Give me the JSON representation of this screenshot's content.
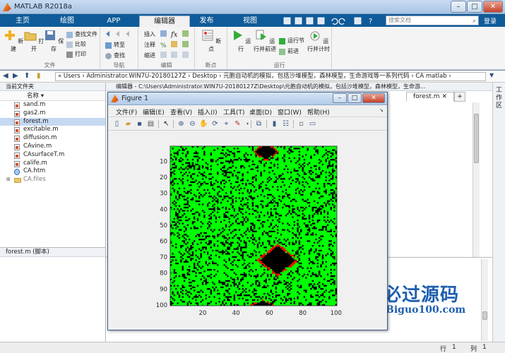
{
  "app": {
    "title": "MATLAB R2018a",
    "window_controls": {
      "minimize": "–",
      "maximize": "□",
      "close": "✕"
    }
  },
  "tabs": [
    {
      "label": "主页",
      "active": false
    },
    {
      "label": "绘图",
      "active": false
    },
    {
      "label": "APP",
      "active": false
    },
    {
      "label": "编辑器",
      "active": true
    },
    {
      "label": "发布",
      "active": false
    },
    {
      "label": "视图",
      "active": false
    }
  ],
  "search": {
    "placeholder": "搜索文档",
    "login_label": "登录"
  },
  "ribbon": {
    "groups": [
      {
        "label": "文件"
      },
      {
        "label": "导航"
      },
      {
        "label": "编辑"
      },
      {
        "label": "断点"
      },
      {
        "label": "运行"
      }
    ],
    "file": {
      "new": "新建",
      "open": "打开",
      "save": "保存",
      "find_files": "查找文件",
      "compare": "比较",
      "print": "打印"
    },
    "navigate": {
      "goto": "转至",
      "find": "查找"
    },
    "edit": {
      "insert": "插入",
      "comment": "注释",
      "indent": "缩进"
    },
    "breakpoints": {
      "label": "断点"
    },
    "run": {
      "run": "运行",
      "run_advance": "运行并前进",
      "run_section": "运行节",
      "advance": "前进",
      "run_time": "运行并计时"
    }
  },
  "address": {
    "path": "«  Users  ›  Administrator.WIN7U-20180127Z  ›  Desktop  ›  元胞自动机的模拟，包括沙堆模型，森林模型，生命游戏等一系列代码  ›  CA matlab  ›"
  },
  "file_browser": {
    "header": "当前文件夹",
    "name_column": "名称",
    "files": [
      {
        "name": "sand.m",
        "type": "m",
        "selected": false
      },
      {
        "name": "gas2.m",
        "type": "m",
        "selected": false
      },
      {
        "name": "forest.m",
        "type": "m",
        "selected": true
      },
      {
        "name": "excitable.m",
        "type": "m",
        "selected": false
      },
      {
        "name": "diffusion.m",
        "type": "m",
        "selected": false
      },
      {
        "name": "CAvine.m",
        "type": "m",
        "selected": false
      },
      {
        "name": "CAsurfaceT.m",
        "type": "m",
        "selected": false
      },
      {
        "name": "calife.m",
        "type": "m",
        "selected": false
      },
      {
        "name": "CA.htm",
        "type": "htm",
        "selected": false
      },
      {
        "name": "CA.files",
        "type": "folder",
        "selected": false
      }
    ],
    "details": "forest.m  (脚本)"
  },
  "editor": {
    "header": "编辑器 - C:\\Users\\Administrator.WIN7U-20180127Z\\Desktop\\元胞自动机的模拟，包括沙堆模型，森林模型，生命游...",
    "tab": "forest.m",
    "add_tab": "+",
    "side_label": "工作区"
  },
  "status": {
    "row_label": "行",
    "row_value": "1",
    "col_label": "列",
    "col_value": "1"
  },
  "figure": {
    "title": "Figure 1",
    "menu": [
      "文件(F)",
      "编辑(E)",
      "查看(V)",
      "插入(I)",
      "工具(T)",
      "桌面(D)",
      "窗口(W)",
      "帮助(H)"
    ],
    "toolbar_icons": [
      "new-figure-icon",
      "open-icon",
      "save-icon",
      "print-icon",
      "pointer-icon",
      "zoom-in-icon",
      "zoom-out-icon",
      "pan-icon",
      "rotate-icon",
      "data-cursor-icon",
      "brush-icon",
      "link-icon",
      "colorbar-icon",
      "legend-icon",
      "hide-tools-icon",
      "dock-icon"
    ]
  },
  "chart_data": {
    "type": "heatmap",
    "grid_size": [
      100,
      100
    ],
    "xlim": [
      0.5,
      100.5
    ],
    "ylim": [
      0.5,
      100.5
    ],
    "y_direction": "reverse",
    "xticks": [
      20,
      40,
      60,
      80,
      100
    ],
    "yticks": [
      10,
      20,
      30,
      40,
      50,
      60,
      70,
      80,
      90,
      100
    ],
    "colors": {
      "tree": "#00ff00",
      "empty": "#000000",
      "fire": "#ff0000"
    },
    "empty_density": 0.22,
    "burned_regions": [
      {
        "center": [
          58,
          4
        ],
        "rx": 7,
        "ry": 5
      },
      {
        "center": [
          65,
          72
        ],
        "rx": 11,
        "ry": 9
      },
      {
        "center": [
          56,
          100
        ],
        "rx": 6,
        "ry": 3
      }
    ]
  },
  "watermark": {
    "text": "必过源码",
    "subtext": "Biguo100.com"
  }
}
